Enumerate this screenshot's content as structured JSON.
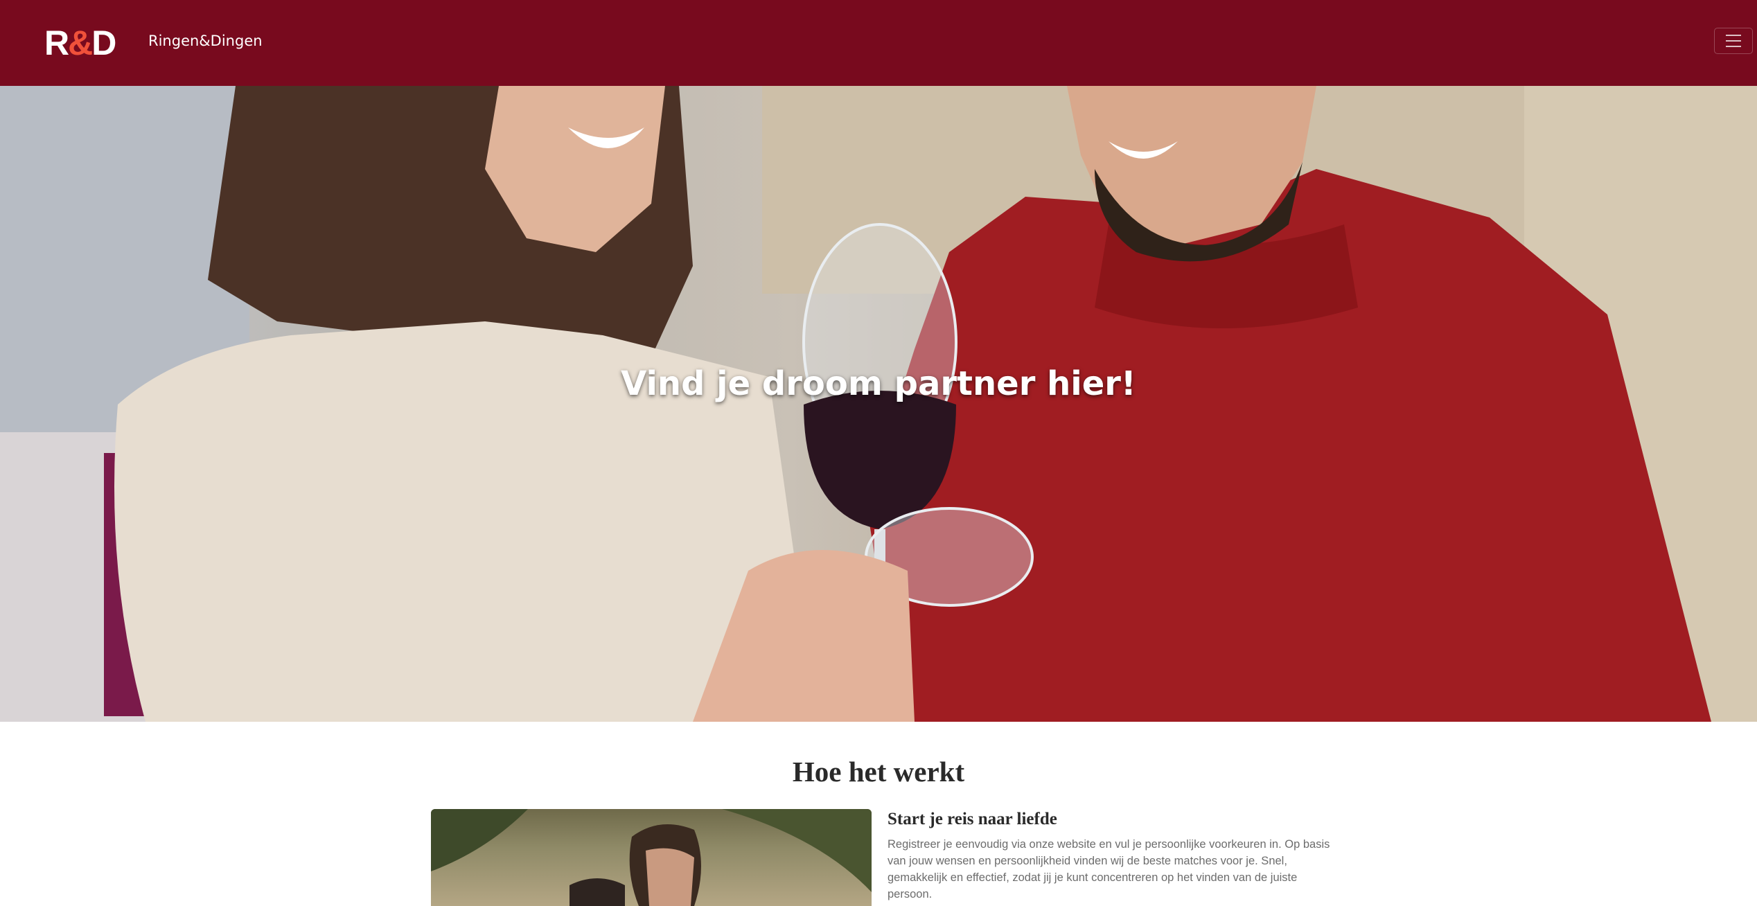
{
  "header": {
    "logo": {
      "r": "R",
      "amp": "&",
      "d": "D"
    },
    "brand_name": "Ringen&Dingen",
    "menu_icon": "hamburger-icon",
    "background_color": "#780a1e",
    "logo_accent_color": "#f0513a"
  },
  "hero": {
    "title": "Vind je droom partner hier!",
    "image": "couple-toasting-red-wine-photo"
  },
  "how_it_works": {
    "title": "Hoe het werkt",
    "steps": [
      {
        "image": "couple-under-palm-trees-photo",
        "title": "Start je reis naar liefde",
        "text": "Registreer je eenvoudig via onze website en vul je persoonlijke voorkeuren in. Op basis van jouw wensen en persoonlijkheid vinden wij de beste matches voor je. Snel, gemakkelijk en effectief, zodat jij je kunt concentreren op het vinden van de juiste persoon."
      }
    ]
  }
}
